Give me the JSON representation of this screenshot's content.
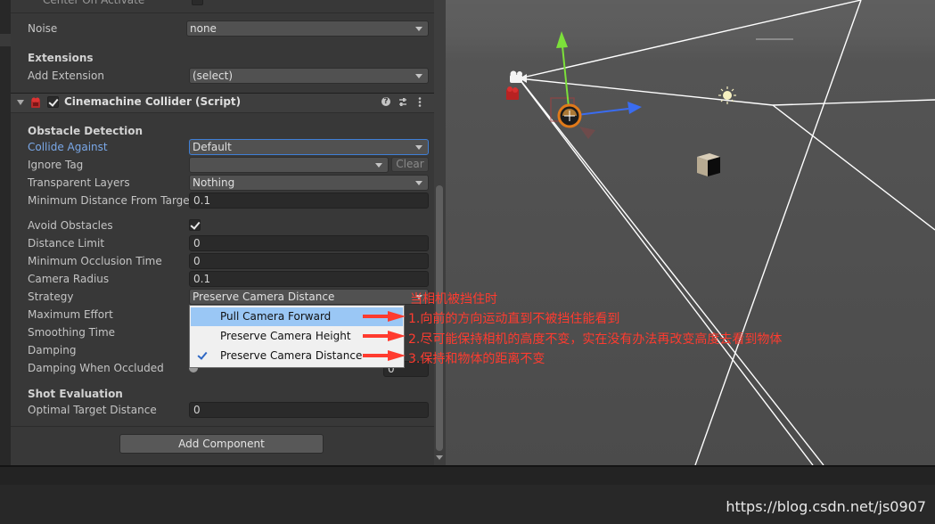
{
  "inspector": {
    "prev_row_label": "Center On Activate",
    "noise": {
      "label": "Noise",
      "value": "none"
    },
    "extensions": {
      "heading": "Extensions",
      "add_label": "Add Extension",
      "add_value": "(select)"
    },
    "component": {
      "title": "Cinemachine Collider (Script)",
      "enabled": true
    },
    "obstacle_detection": {
      "heading": "Obstacle Detection",
      "collide_against": {
        "label": "Collide Against",
        "value": "Default"
      },
      "ignore_tag": {
        "label": "Ignore Tag",
        "value": "",
        "clear_label": "Clear"
      },
      "transparent_layers": {
        "label": "Transparent Layers",
        "value": "Nothing"
      },
      "min_distance": {
        "label": "Minimum Distance From Target",
        "value": "0.1"
      }
    },
    "avoid": {
      "avoid_obstacles": {
        "label": "Avoid Obstacles",
        "checked": true
      },
      "distance_limit": {
        "label": "Distance Limit",
        "value": "0"
      },
      "min_occlusion_time": {
        "label": "Minimum Occlusion Time",
        "value": "0"
      },
      "camera_radius": {
        "label": "Camera Radius",
        "value": "0.1"
      },
      "strategy": {
        "label": "Strategy",
        "value": "Preserve Camera Distance"
      },
      "max_effort": {
        "label": "Maximum Effort"
      },
      "smoothing_time": {
        "label": "Smoothing Time"
      },
      "damping": {
        "label": "Damping"
      },
      "damping_when_occluded": {
        "label": "Damping When Occluded",
        "value": "0"
      }
    },
    "shot_evaluation": {
      "heading": "Shot Evaluation",
      "optimal_target_distance": {
        "label": "Optimal Target Distance",
        "value": "0"
      }
    },
    "add_component_label": "Add Component"
  },
  "strategy_popup": {
    "options": [
      {
        "label": "Pull Camera Forward",
        "highlighted": true,
        "checked": false
      },
      {
        "label": "Preserve Camera Height",
        "highlighted": false,
        "checked": false
      },
      {
        "label": "Preserve Camera Distance",
        "highlighted": false,
        "checked": true
      }
    ]
  },
  "annotations": {
    "title": "当相机被挡住时",
    "note1": "1.向前的方向运动直到不被挡住能看到",
    "note2": "2.尽可能保持相机的高度不变，实在没有办法再改变高度去看到物体",
    "note3": "3.保持和物体的距离不变"
  },
  "watermark": "https://blog.csdn.net/js0907",
  "colors": {
    "inspector_bg": "#383838",
    "scene_bg": "#585858",
    "label_highlight": "#7aa8e8",
    "annotation_red": "#ff3b2f",
    "popup_highlight": "#9ac7f5",
    "gizmo_y": "#7ce03a",
    "gizmo_z": "#3a6cf0"
  }
}
